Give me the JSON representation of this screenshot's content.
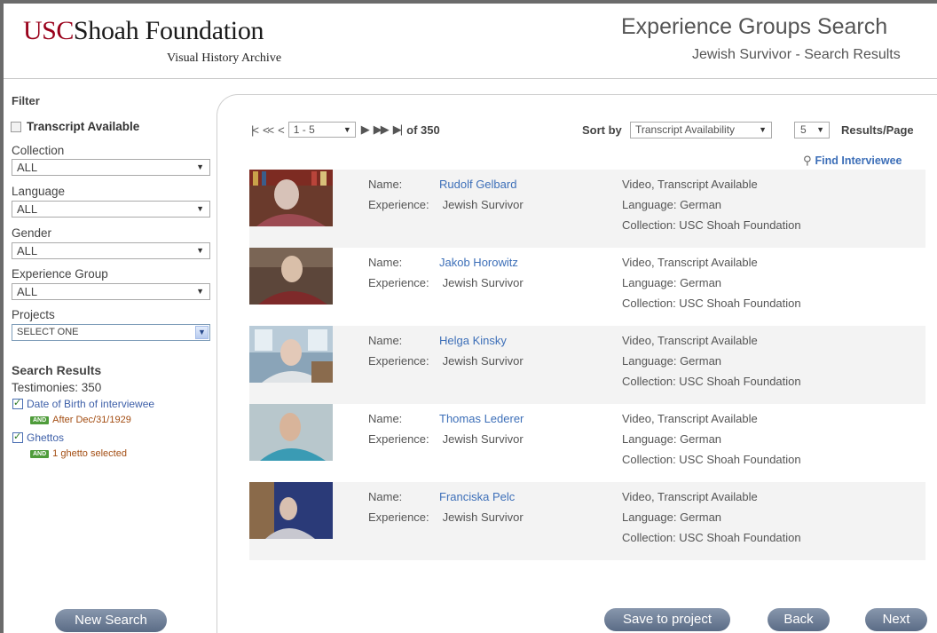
{
  "header": {
    "logo_usc": "USC",
    "logo_name": "Shoah Foundation",
    "logo_sub": "Visual History Archive",
    "title": "Experience Groups Search",
    "subtitle": "Jewish Survivor - Search Results"
  },
  "sidebar": {
    "filter_title": "Filter",
    "transcript_label": "Transcript Available",
    "transcript_checked": false,
    "filters": [
      {
        "label": "Collection",
        "value": "ALL"
      },
      {
        "label": "Language",
        "value": "ALL"
      },
      {
        "label": "Gender",
        "value": "ALL"
      },
      {
        "label": "Experience Group",
        "value": "ALL"
      },
      {
        "label": "Projects",
        "value": "SELECT ONE"
      }
    ],
    "search_results_title": "Search Results",
    "testimonies_count": "Testimonies: 350",
    "criteria": [
      {
        "label": "Date of Birth of interviewee",
        "badge": "AND",
        "value": "After Dec/31/1929"
      },
      {
        "label": "Ghettos",
        "badge": "AND",
        "value": "1 ghetto selected"
      }
    ],
    "new_search_label": "New Search"
  },
  "toolbar": {
    "page_range": "1 - 5",
    "of_total": "of 350",
    "sort_label": "Sort by",
    "sort_value": "Transcript Availability",
    "results_per_page": "5",
    "results_per_page_label": "Results/Page",
    "find_label": "Find Interviewee"
  },
  "results": [
    {
      "name_key": "Name:",
      "name": "Rudolf Gelbard",
      "exp_key": "Experience:",
      "experience": "Jewish Survivor",
      "media": "Video, Transcript Available",
      "language": "Language: German",
      "collection": "Collection: USC Shoah Foundation"
    },
    {
      "name_key": "Name:",
      "name": "Jakob Horowitz",
      "exp_key": "Experience:",
      "experience": "Jewish Survivor",
      "media": "Video, Transcript Available",
      "language": "Language: German",
      "collection": "Collection: USC Shoah Foundation"
    },
    {
      "name_key": "Name:",
      "name": "Helga Kinsky",
      "exp_key": "Experience:",
      "experience": "Jewish Survivor",
      "media": "Video, Transcript Available",
      "language": "Language: German",
      "collection": "Collection: USC Shoah Foundation"
    },
    {
      "name_key": "Name:",
      "name": "Thomas Lederer",
      "exp_key": "Experience:",
      "experience": "Jewish Survivor",
      "media": "Video, Transcript Available",
      "language": "Language: German",
      "collection": "Collection: USC Shoah Foundation"
    },
    {
      "name_key": "Name:",
      "name": "Franciska Pelc",
      "exp_key": "Experience:",
      "experience": "Jewish Survivor",
      "media": "Video, Transcript Available",
      "language": "Language: German",
      "collection": "Collection: USC Shoah Foundation"
    }
  ],
  "actions": {
    "save_label": "Save to project",
    "back_label": "Back",
    "next_label": "Next"
  },
  "colors": {
    "brand_red": "#99001a",
    "link_blue": "#3d6fb8",
    "button_slate": "#6b7a92",
    "and_green": "#4f9c3b"
  }
}
